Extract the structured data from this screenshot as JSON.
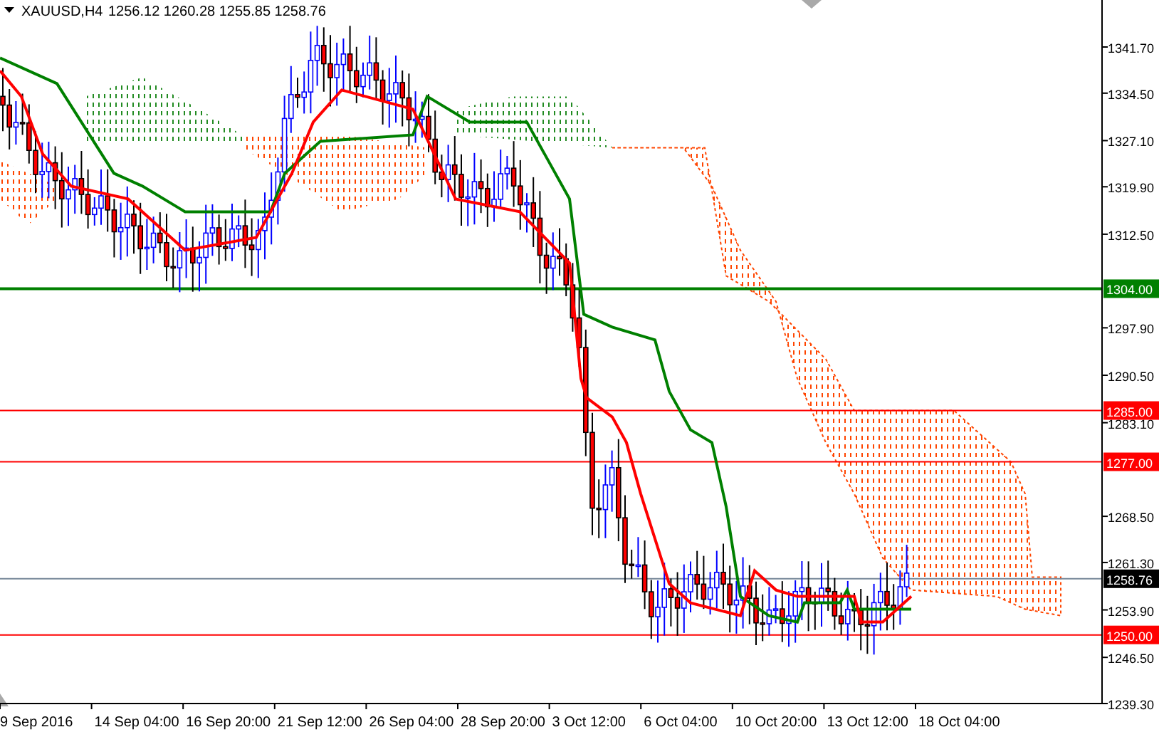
{
  "chart_header": {
    "symbol": "XAUUSD,H4",
    "ohlc": "1256.12 1260.28 1255.85 1258.76"
  },
  "price_axis": {
    "ticks": [
      "1341.70",
      "1334.50",
      "1327.10",
      "1319.90",
      "1312.50",
      "1297.90",
      "1290.50",
      "1283.10",
      "1268.50",
      "1261.30",
      "1253.90",
      "1246.50",
      "1239.30"
    ]
  },
  "time_axis": {
    "ticks": [
      "9 Sep 2016",
      "14 Sep 04:00",
      "16 Sep 20:00",
      "21 Sep 12:00",
      "26 Sep 04:00",
      "28 Sep 20:00",
      "3 Oct 12:00",
      "6 Oct 04:00",
      "10 Oct 20:00",
      "13 Oct 12:00",
      "18 Oct 04:00"
    ]
  },
  "price_levels": [
    {
      "label": "1304.00",
      "kind": "level",
      "color": "#008000"
    },
    {
      "label": "1285.00",
      "kind": "level",
      "color": "#ff0000"
    },
    {
      "label": "1277.00",
      "kind": "level",
      "color": "#ff0000"
    },
    {
      "label": "1258.76",
      "kind": "bid",
      "color": "#000000"
    },
    {
      "label": "1250.00",
      "kind": "level",
      "color": "#ff0000"
    }
  ]
}
